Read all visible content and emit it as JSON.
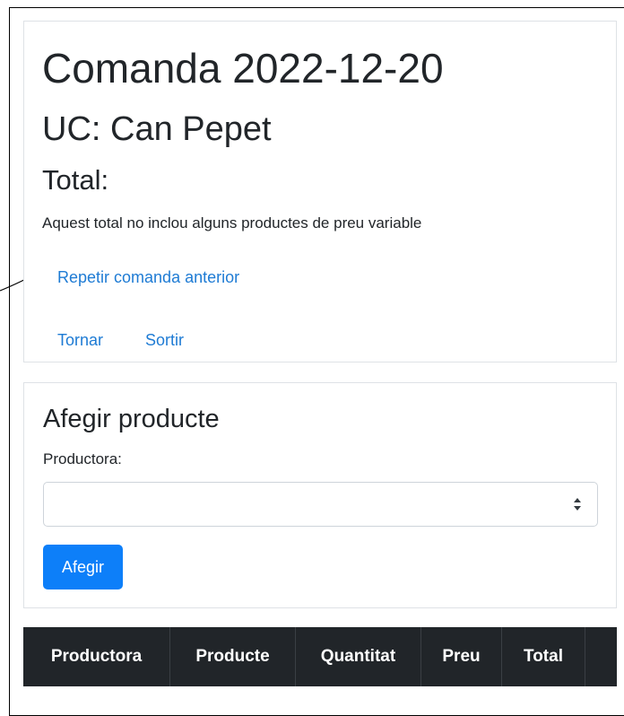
{
  "order": {
    "title": "Comanda 2022-12-20",
    "customer": "UC: Can Pepet",
    "total_label": "Total:",
    "note": "Aquest total no inclou alguns productes de preu variable",
    "repeat_link": "Repetir comanda anterior",
    "back_link": "Tornar",
    "exit_link": "Sortir"
  },
  "add_product": {
    "title": "Afegir producte",
    "producer_label": "Productora:",
    "producer_selected": "",
    "button_label": "Afegir"
  },
  "table": {
    "columns": [
      "Productora",
      "Producte",
      "Quantitat",
      "Preu",
      "Total",
      ""
    ]
  },
  "theme": {
    "link_color": "#1e7bd4",
    "primary_button_color": "#0d7ff9",
    "table_header_color": "#212529"
  },
  "icons": {
    "select_arrows": "updown-chevron-icon",
    "pointer": "arrow-icon"
  }
}
